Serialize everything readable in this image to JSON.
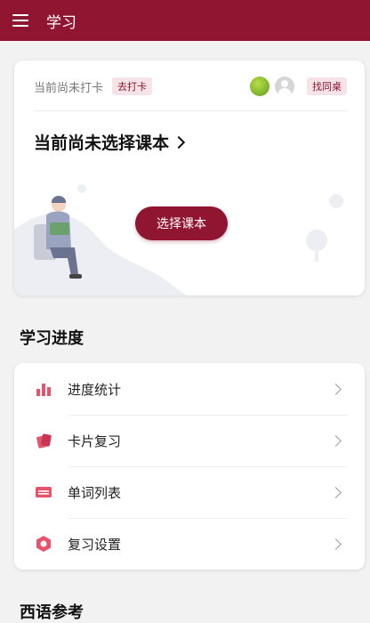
{
  "header": {
    "title": "学习",
    "menu_icon": "menu-icon"
  },
  "checkin": {
    "status_text": "当前尚未打卡",
    "checkin_button": "去打卡",
    "desk_button": "找同桌"
  },
  "book": {
    "title": "当前尚未选择课本",
    "select_button": "选择课本"
  },
  "sections": {
    "progress_title": "学习进度",
    "reference_title": "西语参考"
  },
  "progress_items": [
    {
      "label": "进度统计",
      "icon": "bar-chart-icon"
    },
    {
      "label": "卡片复习",
      "icon": "cards-icon"
    },
    {
      "label": "单词列表",
      "icon": "word-list-icon"
    },
    {
      "label": "复习设置",
      "icon": "settings-icon"
    }
  ],
  "colors": {
    "brand": "#8f1530",
    "icon_accent": "#e8526a"
  }
}
